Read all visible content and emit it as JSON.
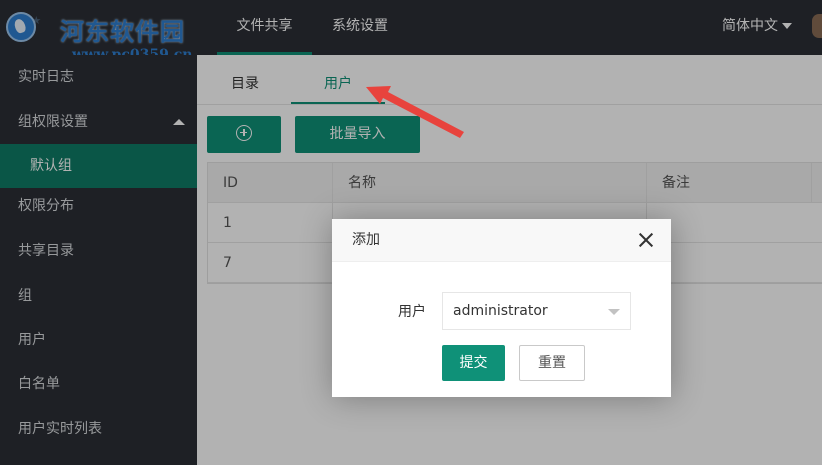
{
  "watermark": {
    "title": "河东软件园",
    "url": "www.pc0359.cn"
  },
  "topnav": {
    "tabs": [
      {
        "label": "文件共享",
        "active": true
      },
      {
        "label": "系统设置",
        "active": false
      }
    ],
    "language": "简体中文"
  },
  "sidebar": {
    "items": [
      {
        "label": "实时日志"
      },
      {
        "label": "组权限设置",
        "expanded": true
      },
      {
        "label": "默认组",
        "active": true
      },
      {
        "label": "权限分布"
      },
      {
        "label": "共享目录"
      },
      {
        "label": "组"
      },
      {
        "label": "用户"
      },
      {
        "label": "白名单"
      },
      {
        "label": "用户实时列表"
      }
    ]
  },
  "subtabs": [
    {
      "label": "目录",
      "active": false
    },
    {
      "label": "用户",
      "active": true
    }
  ],
  "toolbar": {
    "add_icon": "plus-circle-icon",
    "batch_import_label": "批量导入"
  },
  "table": {
    "headers": [
      "ID",
      "名称",
      "备注"
    ],
    "rows": [
      {
        "id": "1",
        "name": "",
        "note": ""
      },
      {
        "id": "7",
        "name": "",
        "note": ""
      }
    ]
  },
  "dialog": {
    "title": "添加",
    "field_label": "用户",
    "select_value": "administrator",
    "submit_label": "提交",
    "reset_label": "重置"
  },
  "colors": {
    "accent": "#0f9178",
    "sidebar_bg": "#2b2f36",
    "arrow": "#e8433d"
  }
}
